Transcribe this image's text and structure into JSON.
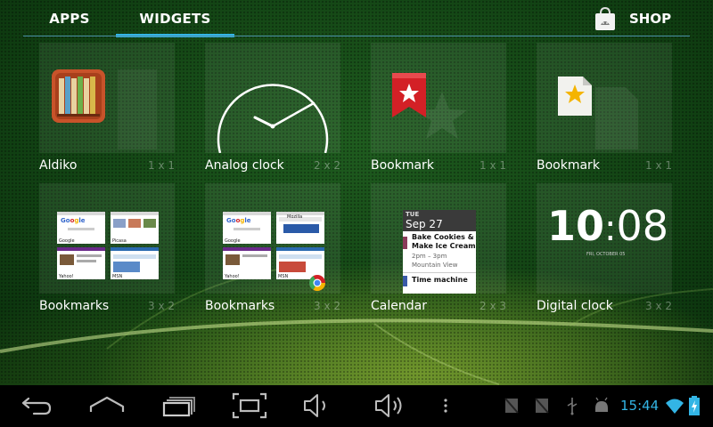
{
  "tabs": [
    {
      "label": "APPS",
      "selected": false
    },
    {
      "label": "WIDGETS",
      "selected": true
    }
  ],
  "shop": {
    "label": "SHOP",
    "icon": "market-bag-icon"
  },
  "widgets": [
    {
      "name": "Aldiko",
      "size": "1 x 1",
      "icon": "bookshelf-icon"
    },
    {
      "name": "Analog clock",
      "size": "2 x 2",
      "icon": "analog-clock-icon"
    },
    {
      "name": "Bookmark",
      "size": "1 x 1",
      "icon": "bookmark-ribbon-icon"
    },
    {
      "name": "Bookmark",
      "size": "1 x 1",
      "icon": "bookmark-file-icon"
    },
    {
      "name": "Bookmarks",
      "size": "3 x 2",
      "icon": "bookmarks-thumbnails"
    },
    {
      "name": "Bookmarks",
      "size": "3 x 2",
      "icon": "bookmarks-thumbnails-chrome"
    },
    {
      "name": "Calendar",
      "size": "2 x 3",
      "icon": "calendar-preview"
    },
    {
      "name": "Digital clock",
      "size": "3 x 2",
      "icon": "digital-clock-preview"
    }
  ],
  "previews": {
    "bookmarks1": [
      "Google",
      "Picasa",
      "Yahoo!",
      "MSN"
    ],
    "bookmarks2": [
      "Google",
      "Mozilla",
      "Yahoo!",
      "MSN"
    ],
    "calendar": {
      "weekday": "TUE",
      "date": "Sep 27",
      "event1_title_1": "Bake Cookies &",
      "event1_title_2": "Make Ice Cream",
      "event1_time": "2pm – 3pm",
      "event1_place": "Mountain View",
      "event2_title": "Time machine"
    },
    "digital_clock": {
      "hours": "10",
      "minutes": "08",
      "date": "FRI, OCTOBER 05"
    }
  },
  "navbar": {
    "buttons": [
      "back-icon",
      "home-icon",
      "recent-apps-icon",
      "screenshot-icon",
      "volume-down-icon",
      "volume-up-icon",
      "menu-icon"
    ],
    "status_icons": [
      "notification-icon",
      "notification-icon-2",
      "usb-icon",
      "android-debug-icon",
      "wifi-icon",
      "battery-charging-icon"
    ],
    "time": "15:44"
  },
  "colors": {
    "accent": "#33b5e5",
    "bookmark_red": "#d32026",
    "bookmark_yellow": "#f4b400"
  }
}
